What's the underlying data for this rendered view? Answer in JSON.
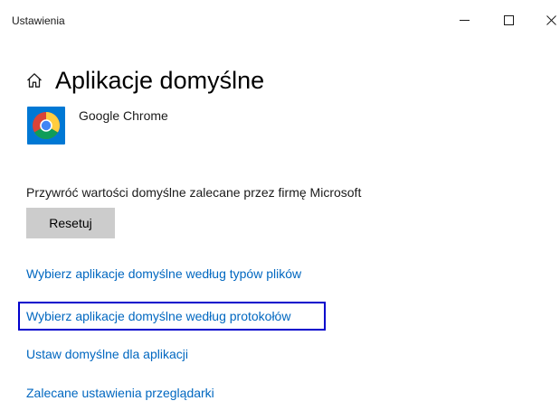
{
  "window": {
    "title": "Ustawienia",
    "controls": {
      "minimize_icon": "minimize-icon",
      "maximize_icon": "maximize-icon",
      "close_icon": "close-icon"
    }
  },
  "header": {
    "home_icon": "home-icon",
    "title": "Aplikacje domyślne"
  },
  "browser": {
    "app_icon": "google-chrome-logo-icon",
    "app_name": "Google Chrome"
  },
  "reset": {
    "description": "Przywróć wartości domyślne zalecane przez firmę Microsoft",
    "button_label": "Resetuj"
  },
  "links": {
    "file_types": "Wybierz aplikacje domyślne według typów plików",
    "protocols": "Wybierz aplikacje domyślne według protokołów",
    "app_defaults": "Ustaw domyślne dla aplikacji",
    "browser_settings": "Zalecane ustawienia przeglądarki"
  },
  "colors": {
    "link": "#0067c0",
    "button_bg": "#cccccc",
    "highlight_border": "#0000cc",
    "background": "#ffffff"
  }
}
